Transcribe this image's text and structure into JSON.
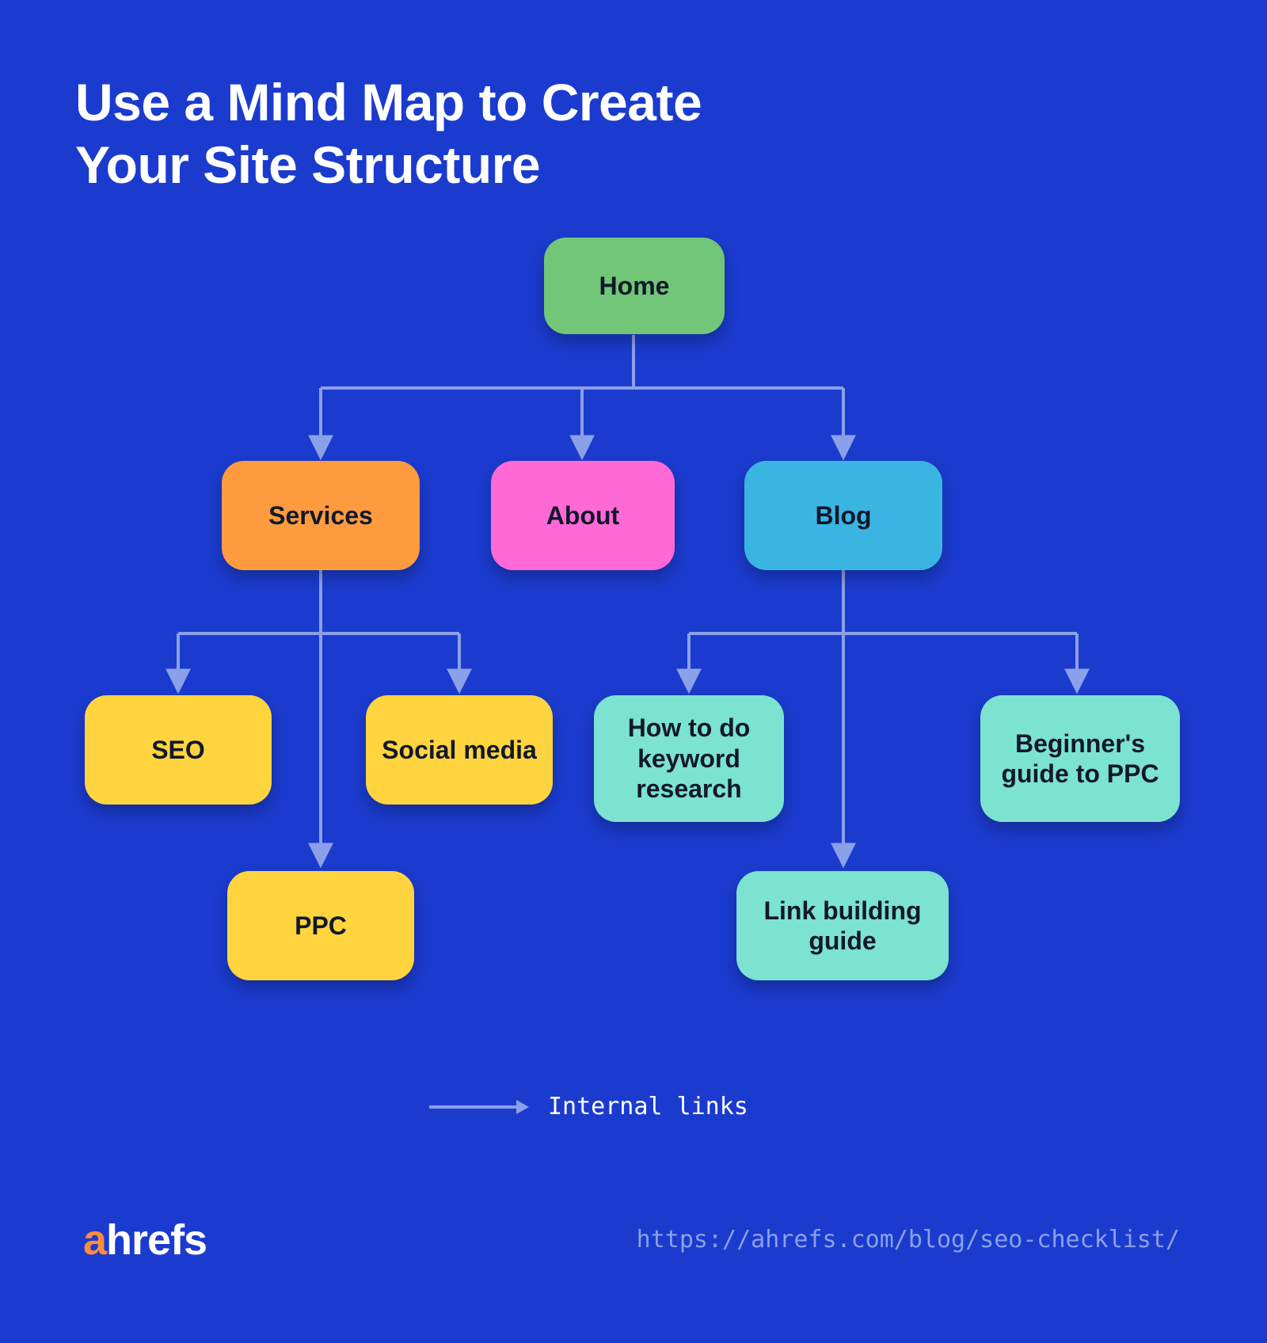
{
  "title": "Use a Mind Map to Create\nYour Site Structure",
  "nodes": {
    "home": "Home",
    "services": "Services",
    "about": "About",
    "blog": "Blog",
    "seo": "SEO",
    "social": "Social media",
    "ppc": "PPC",
    "howto": "How to do keyword research",
    "beginners": "Beginner's guide to PPC",
    "link": "Link building guide"
  },
  "legend": {
    "label": "Internal links"
  },
  "footer": {
    "logo_a": "a",
    "logo_rest": "hrefs",
    "url": "https://ahrefs.com/blog/seo-checklist/"
  },
  "colors": {
    "bg": "#1b3bce",
    "arrow": "#8aa0e9",
    "green": "#71c678",
    "orange": "#ff9b3f",
    "pink": "#ff69d6",
    "blue": "#3ab5e2",
    "yellow": "#ffd43f",
    "teal": "#7be3d0"
  }
}
